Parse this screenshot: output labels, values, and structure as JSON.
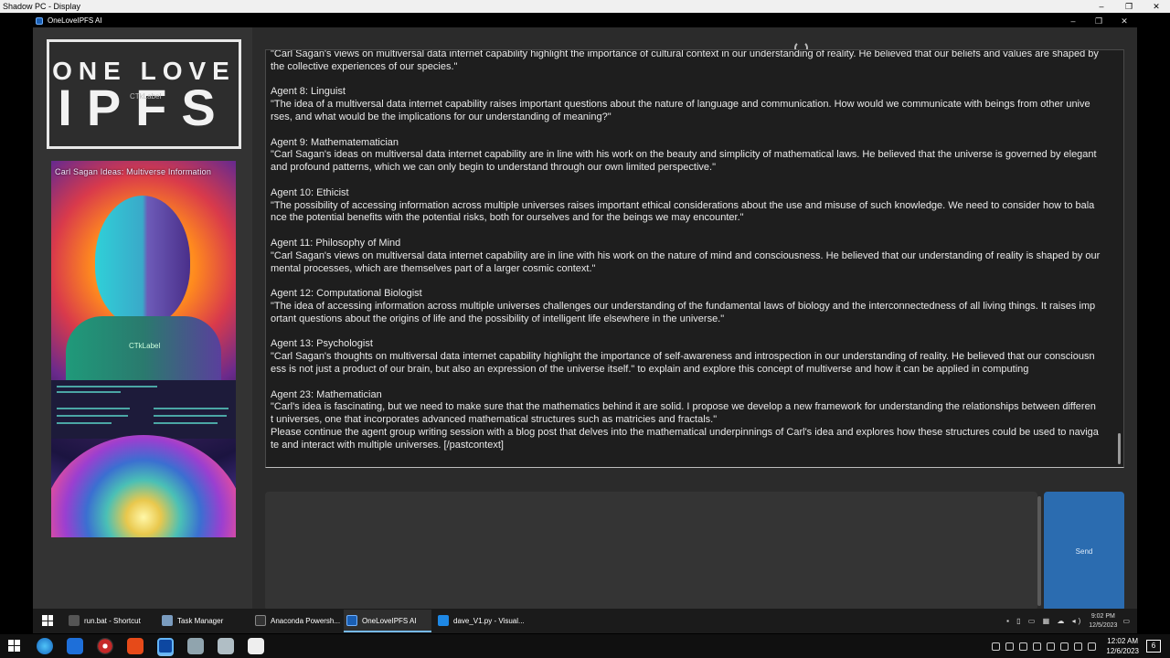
{
  "outer_window": {
    "title": "Shadow PC - Display",
    "controls": [
      "–",
      "❐",
      "✕"
    ]
  },
  "app_window": {
    "title": "OneLoveIPFS AI",
    "controls": [
      "–",
      "❐",
      "✕"
    ]
  },
  "sidebar": {
    "logo": {
      "line1": "ONE LOVE",
      "line2": "IPFS",
      "widget_label": "CTkLabel"
    },
    "poster": {
      "title": "Carl Sagan Ideas: Multiverse Information",
      "widget_label": "CTkLabel"
    }
  },
  "chat": {
    "lines": [
      {
        "id": "l0",
        "text": "\"Carl Sagan's views on multiversal data internet capability highlight the importance of cultural context in our understanding of reality. He believed that our beliefs and values are shaped by"
      },
      {
        "id": "l1",
        "text": "the collective experiences of our species.\""
      },
      {
        "id": "g1",
        "text": ""
      },
      {
        "id": "l2",
        "text": "Agent 8: Linguist"
      },
      {
        "id": "l3",
        "text": "\"The idea of a multiversal data internet capability raises important questions about the nature of language and communication. How would we communicate with beings from other unive"
      },
      {
        "id": "l4",
        "text": "rses, and what would be the implications for our understanding of meaning?\""
      },
      {
        "id": "g2",
        "text": ""
      },
      {
        "id": "l5",
        "text": "Agent 9: Mathematematician"
      },
      {
        "id": "l6",
        "text": "\"Carl Sagan's ideas on multiversal data internet capability are in line with his work on the beauty and simplicity of mathematical laws. He believed that the universe is governed by elegant"
      },
      {
        "id": "l7",
        "text": "and profound patterns, which we can only begin to understand through our own limited perspective.\""
      },
      {
        "id": "g3",
        "text": ""
      },
      {
        "id": "l8",
        "text": "Agent 10: Ethicist"
      },
      {
        "id": "l9",
        "text": "\"The possibility of accessing information across multiple universes raises important ethical considerations about the use and misuse of such knowledge. We need to consider how to bala"
      },
      {
        "id": "l10",
        "text": "nce the potential benefits with the potential risks, both for ourselves and for the beings we may encounter.\""
      },
      {
        "id": "g4",
        "text": ""
      },
      {
        "id": "l11",
        "text": "Agent 11: Philosophy of Mind"
      },
      {
        "id": "l12",
        "text": "\"Carl Sagan's views on multiversal data internet capability are in line with his work on the nature of mind and consciousness. He believed that our understanding of reality is shaped by our"
      },
      {
        "id": "l13",
        "text": "mental processes, which are themselves part of a larger cosmic context.\""
      },
      {
        "id": "g5",
        "text": ""
      },
      {
        "id": "l14",
        "text": "Agent 12: Computational Biologist"
      },
      {
        "id": "l15",
        "text": "\"The idea of accessing information across multiple universes challenges our understanding of the fundamental laws of biology and the interconnectedness of all living things. It raises imp"
      },
      {
        "id": "l16",
        "text": "ortant questions about the origins of life and the possibility of intelligent life elsewhere in the universe.\""
      },
      {
        "id": "g6",
        "text": ""
      },
      {
        "id": "l17",
        "text": "Agent 13: Psychologist"
      },
      {
        "id": "l18",
        "text": "\"Carl Sagan's thoughts on multiversal data internet capability highlight the importance of self-awareness and introspection in our understanding of reality. He believed that our consciousn"
      },
      {
        "id": "l19",
        "text": "ess is not just a product of our brain, but also an expression of the universe itself.\" to explain and explore this concept of multiverse and how it can be applied in computing"
      },
      {
        "id": "g7",
        "text": ""
      },
      {
        "id": "l20",
        "text": "Agent 23: Mathematician"
      },
      {
        "id": "l21",
        "text": "\"Carl's idea is fascinating, but we need to make sure that the mathematics behind it are solid. I propose we develop a new framework for understanding the relationships between differen"
      },
      {
        "id": "l22",
        "text": "t universes, one that incorporates advanced mathematical structures such as matricies and fractals.\""
      },
      {
        "id": "l23",
        "text": "Please continue the agent group writing session with a blog post that delves into the mathematical underpinnings of Carl's idea and explores how these structures could be used to naviga"
      },
      {
        "id": "l24",
        "text": "te and interact with multiple universes. [/pastcontext]"
      }
    ]
  },
  "input": {
    "value": "",
    "placeholder": ""
  },
  "send_button": {
    "label": "Send"
  },
  "inner_taskbar": {
    "items": [
      {
        "label": "run.bat - Shortcut",
        "color": "#555555"
      },
      {
        "label": "Task Manager",
        "color": "#7a9cbf"
      },
      {
        "label": "Anaconda Powersh...",
        "color": "#333333"
      },
      {
        "label": "OneLoveIPFS AI",
        "color": "#1a5fb4"
      },
      {
        "label": "dave_V1.py - Visual...",
        "color": "#1e88e5"
      }
    ],
    "clock": {
      "time": "9:02 PM",
      "date": "12/5/2023"
    }
  },
  "outer_taskbar": {
    "clock": {
      "time": "12:02 AM",
      "date": "12/6/2023"
    },
    "notification_count": "6"
  },
  "colors": {
    "accent": "#2b6cb0",
    "app_background": "#2b2b2b",
    "textbox_background": "#1e1e1e",
    "text": "#e9e9e9"
  }
}
